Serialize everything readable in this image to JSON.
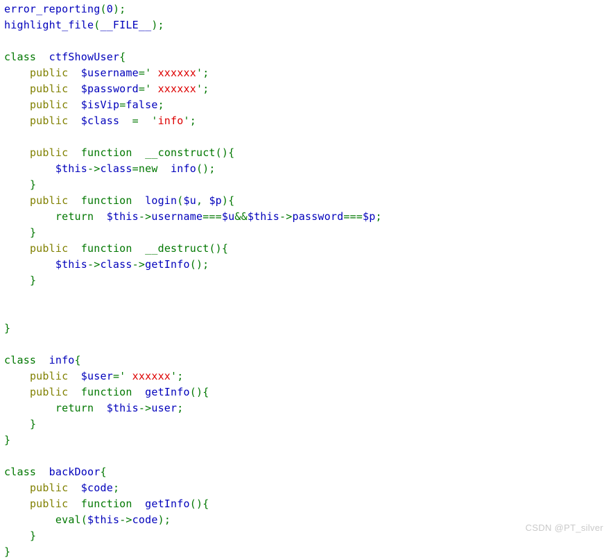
{
  "page": {
    "background": "#ffffff",
    "watermark": "CSDN @PT_silver"
  },
  "palette": {
    "default": "#0000BB",
    "keyword": "#007700",
    "string": "#DD0000",
    "public_modifier": "#808000",
    "watermark": "#c9c9c9"
  },
  "code": {
    "language": "php",
    "rendered_by": "highlight_file",
    "lines": [
      {
        "n": 1,
        "text": "error_reporting(0);"
      },
      {
        "n": 2,
        "text": "highlight_file(__FILE__);"
      },
      {
        "n": 3,
        "text": ""
      },
      {
        "n": 4,
        "text": "class  ctfShowUser{"
      },
      {
        "n": 5,
        "text": "    public  $username=' xxxxxx';"
      },
      {
        "n": 6,
        "text": "    public  $password=' xxxxxx';"
      },
      {
        "n": 7,
        "text": "    public  $isVip=false;"
      },
      {
        "n": 8,
        "text": "    public  $class  =  'info';"
      },
      {
        "n": 9,
        "text": ""
      },
      {
        "n": 10,
        "text": "    public  function  __construct(){"
      },
      {
        "n": 11,
        "text": "        $this->class=new  info();"
      },
      {
        "n": 12,
        "text": "    }"
      },
      {
        "n": 13,
        "text": "    public  function  login($u, $p){"
      },
      {
        "n": 14,
        "text": "        return  $this->username===$u&&$this->password===$p;"
      },
      {
        "n": 15,
        "text": "    }"
      },
      {
        "n": 16,
        "text": "    public  function  __destruct(){"
      },
      {
        "n": 17,
        "text": "        $this->class->getInfo();"
      },
      {
        "n": 18,
        "text": "    }"
      },
      {
        "n": 19,
        "text": ""
      },
      {
        "n": 20,
        "text": ""
      },
      {
        "n": 21,
        "text": "}"
      },
      {
        "n": 22,
        "text": ""
      },
      {
        "n": 23,
        "text": "class  info{"
      },
      {
        "n": 24,
        "text": "    public  $user=' xxxxxx';"
      },
      {
        "n": 25,
        "text": "    public  function  getInfo(){"
      },
      {
        "n": 26,
        "text": "        return  $this->user;"
      },
      {
        "n": 27,
        "text": "    }"
      },
      {
        "n": 28,
        "text": "}"
      },
      {
        "n": 29,
        "text": ""
      },
      {
        "n": 30,
        "text": "class  backDoor{"
      },
      {
        "n": 31,
        "text": "    public  $code;"
      },
      {
        "n": 32,
        "text": "    public  function  getInfo(){"
      },
      {
        "n": 33,
        "text": "        eval($this->code);"
      },
      {
        "n": 34,
        "text": "    }"
      },
      {
        "n": 35,
        "text": "}"
      }
    ],
    "tokens": [
      [
        {
          "c": "default",
          "t": "error_reporting"
        },
        {
          "c": "keyword",
          "t": "("
        },
        {
          "c": "default",
          "t": "0"
        },
        {
          "c": "keyword",
          "t": ");"
        }
      ],
      [
        {
          "c": "default",
          "t": "highlight_file"
        },
        {
          "c": "keyword",
          "t": "("
        },
        {
          "c": "default",
          "t": "__FILE__"
        },
        {
          "c": "keyword",
          "t": ");"
        }
      ],
      [
        {
          "c": "default",
          "t": ""
        }
      ],
      [
        {
          "c": "keyword",
          "t": "class"
        },
        {
          "c": "default",
          "t": "  ctfShowUser"
        },
        {
          "c": "keyword",
          "t": "{"
        }
      ],
      [
        {
          "c": "default",
          "t": "    "
        },
        {
          "c": "public",
          "t": "public"
        },
        {
          "c": "default",
          "t": "  $username"
        },
        {
          "c": "keyword",
          "t": "='"
        },
        {
          "c": "string",
          "t": " xxxxxx"
        },
        {
          "c": "keyword",
          "t": "';"
        }
      ],
      [
        {
          "c": "default",
          "t": "    "
        },
        {
          "c": "public",
          "t": "public"
        },
        {
          "c": "default",
          "t": "  $password"
        },
        {
          "c": "keyword",
          "t": "='"
        },
        {
          "c": "string",
          "t": " xxxxxx"
        },
        {
          "c": "keyword",
          "t": "';"
        }
      ],
      [
        {
          "c": "default",
          "t": "    "
        },
        {
          "c": "public",
          "t": "public"
        },
        {
          "c": "default",
          "t": "  $isVip"
        },
        {
          "c": "keyword",
          "t": "="
        },
        {
          "c": "default",
          "t": "false"
        },
        {
          "c": "keyword",
          "t": ";"
        }
      ],
      [
        {
          "c": "default",
          "t": "    "
        },
        {
          "c": "public",
          "t": "public"
        },
        {
          "c": "default",
          "t": "  $class  "
        },
        {
          "c": "keyword",
          "t": "=  '"
        },
        {
          "c": "string",
          "t": "info"
        },
        {
          "c": "keyword",
          "t": "';"
        }
      ],
      [
        {
          "c": "default",
          "t": ""
        }
      ],
      [
        {
          "c": "default",
          "t": "    "
        },
        {
          "c": "public",
          "t": "public"
        },
        {
          "c": "default",
          "t": "  "
        },
        {
          "c": "keyword",
          "t": "function"
        },
        {
          "c": "default",
          "t": "  "
        },
        {
          "c": "keyword",
          "t": "__construct"
        },
        {
          "c": "keyword",
          "t": "(){"
        }
      ],
      [
        {
          "c": "default",
          "t": "        $this"
        },
        {
          "c": "keyword",
          "t": "->"
        },
        {
          "c": "default",
          "t": "class"
        },
        {
          "c": "keyword",
          "t": "=new"
        },
        {
          "c": "default",
          "t": "  info"
        },
        {
          "c": "keyword",
          "t": "();"
        }
      ],
      [
        {
          "c": "default",
          "t": "    "
        },
        {
          "c": "keyword",
          "t": "}"
        }
      ],
      [
        {
          "c": "default",
          "t": "    "
        },
        {
          "c": "public",
          "t": "public"
        },
        {
          "c": "default",
          "t": "  "
        },
        {
          "c": "keyword",
          "t": "function"
        },
        {
          "c": "default",
          "t": "  login"
        },
        {
          "c": "keyword",
          "t": "("
        },
        {
          "c": "default",
          "t": "$u"
        },
        {
          "c": "keyword",
          "t": ","
        },
        {
          "c": "default",
          "t": " $p"
        },
        {
          "c": "keyword",
          "t": "){"
        }
      ],
      [
        {
          "c": "default",
          "t": "        "
        },
        {
          "c": "keyword",
          "t": "return"
        },
        {
          "c": "default",
          "t": "  $this"
        },
        {
          "c": "keyword",
          "t": "->"
        },
        {
          "c": "default",
          "t": "username"
        },
        {
          "c": "keyword",
          "t": "==="
        },
        {
          "c": "default",
          "t": "$u"
        },
        {
          "c": "keyword",
          "t": "&&"
        },
        {
          "c": "default",
          "t": "$this"
        },
        {
          "c": "keyword",
          "t": "->"
        },
        {
          "c": "default",
          "t": "password"
        },
        {
          "c": "keyword",
          "t": "==="
        },
        {
          "c": "default",
          "t": "$p"
        },
        {
          "c": "keyword",
          "t": ";"
        }
      ],
      [
        {
          "c": "default",
          "t": "    "
        },
        {
          "c": "keyword",
          "t": "}"
        }
      ],
      [
        {
          "c": "default",
          "t": "    "
        },
        {
          "c": "public",
          "t": "public"
        },
        {
          "c": "default",
          "t": "  "
        },
        {
          "c": "keyword",
          "t": "function"
        },
        {
          "c": "default",
          "t": "  "
        },
        {
          "c": "keyword",
          "t": "__destruct"
        },
        {
          "c": "keyword",
          "t": "(){"
        }
      ],
      [
        {
          "c": "default",
          "t": "        $this"
        },
        {
          "c": "keyword",
          "t": "->"
        },
        {
          "c": "default",
          "t": "class"
        },
        {
          "c": "keyword",
          "t": "->"
        },
        {
          "c": "default",
          "t": "getInfo"
        },
        {
          "c": "keyword",
          "t": "();"
        }
      ],
      [
        {
          "c": "default",
          "t": "    "
        },
        {
          "c": "keyword",
          "t": "}"
        }
      ],
      [
        {
          "c": "default",
          "t": ""
        }
      ],
      [
        {
          "c": "default",
          "t": ""
        }
      ],
      [
        {
          "c": "keyword",
          "t": "}"
        }
      ],
      [
        {
          "c": "default",
          "t": ""
        }
      ],
      [
        {
          "c": "keyword",
          "t": "class"
        },
        {
          "c": "default",
          "t": "  info"
        },
        {
          "c": "keyword",
          "t": "{"
        }
      ],
      [
        {
          "c": "default",
          "t": "    "
        },
        {
          "c": "public",
          "t": "public"
        },
        {
          "c": "default",
          "t": "  $user"
        },
        {
          "c": "keyword",
          "t": "='"
        },
        {
          "c": "string",
          "t": " xxxxxx"
        },
        {
          "c": "keyword",
          "t": "';"
        }
      ],
      [
        {
          "c": "default",
          "t": "    "
        },
        {
          "c": "public",
          "t": "public"
        },
        {
          "c": "default",
          "t": "  "
        },
        {
          "c": "keyword",
          "t": "function"
        },
        {
          "c": "default",
          "t": "  getInfo"
        },
        {
          "c": "keyword",
          "t": "(){"
        }
      ],
      [
        {
          "c": "default",
          "t": "        "
        },
        {
          "c": "keyword",
          "t": "return"
        },
        {
          "c": "default",
          "t": "  $this"
        },
        {
          "c": "keyword",
          "t": "->"
        },
        {
          "c": "default",
          "t": "user"
        },
        {
          "c": "keyword",
          "t": ";"
        }
      ],
      [
        {
          "c": "default",
          "t": "    "
        },
        {
          "c": "keyword",
          "t": "}"
        }
      ],
      [
        {
          "c": "keyword",
          "t": "}"
        }
      ],
      [
        {
          "c": "default",
          "t": ""
        }
      ],
      [
        {
          "c": "keyword",
          "t": "class"
        },
        {
          "c": "default",
          "t": "  backDoor"
        },
        {
          "c": "keyword",
          "t": "{"
        }
      ],
      [
        {
          "c": "default",
          "t": "    "
        },
        {
          "c": "public",
          "t": "public"
        },
        {
          "c": "default",
          "t": "  $code"
        },
        {
          "c": "keyword",
          "t": ";"
        }
      ],
      [
        {
          "c": "default",
          "t": "    "
        },
        {
          "c": "public",
          "t": "public"
        },
        {
          "c": "default",
          "t": "  "
        },
        {
          "c": "keyword",
          "t": "function"
        },
        {
          "c": "default",
          "t": "  getInfo"
        },
        {
          "c": "keyword",
          "t": "(){"
        }
      ],
      [
        {
          "c": "default",
          "t": "        "
        },
        {
          "c": "keyword",
          "t": "eval"
        },
        {
          "c": "keyword",
          "t": "("
        },
        {
          "c": "default",
          "t": "$this"
        },
        {
          "c": "keyword",
          "t": "->"
        },
        {
          "c": "default",
          "t": "code"
        },
        {
          "c": "keyword",
          "t": ");"
        }
      ],
      [
        {
          "c": "default",
          "t": "    "
        },
        {
          "c": "keyword",
          "t": "}"
        }
      ],
      [
        {
          "c": "keyword",
          "t": "}"
        }
      ]
    ]
  }
}
